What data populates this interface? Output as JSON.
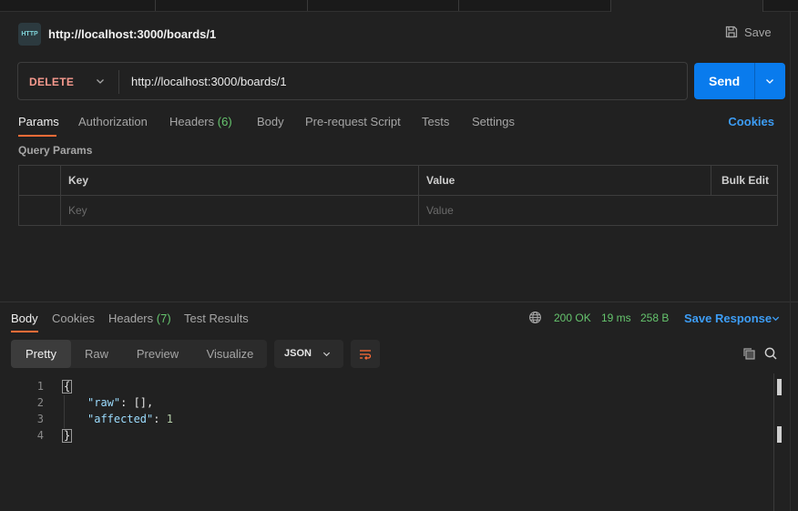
{
  "request": {
    "title": "http://localhost:3000/boards/1",
    "icon_text": "HTTP",
    "save_label": "Save",
    "method": "DELETE",
    "url": "http://localhost:3000/boards/1",
    "send_label": "Send"
  },
  "request_tabs": [
    {
      "label": "Params",
      "active": true
    },
    {
      "label": "Authorization"
    },
    {
      "label": "Headers",
      "count": "(6)"
    },
    {
      "label": "Body"
    },
    {
      "label": "Pre-request Script"
    },
    {
      "label": "Tests"
    },
    {
      "label": "Settings"
    }
  ],
  "cookies_label": "Cookies",
  "query_params": {
    "label": "Query Params",
    "headers": {
      "key": "Key",
      "value": "Value",
      "bulk_edit": "Bulk Edit"
    },
    "placeholders": {
      "key": "Key",
      "value": "Value"
    }
  },
  "response": {
    "tabs": [
      {
        "label": "Body",
        "active": true
      },
      {
        "label": "Cookies"
      },
      {
        "label": "Headers",
        "count": "(7)"
      },
      {
        "label": "Test Results"
      }
    ],
    "status": "200 OK",
    "time": "19 ms",
    "size": "258 B",
    "save_response_label": "Save Response",
    "views": [
      "Pretty",
      "Raw",
      "Preview",
      "Visualize"
    ],
    "format": "JSON",
    "body_lines": [
      {
        "n": "1",
        "text": "{"
      },
      {
        "n": "2",
        "key": "\"raw\"",
        "rest": ": [],"
      },
      {
        "n": "3",
        "key": "\"affected\"",
        "sep": ": ",
        "num": "1"
      },
      {
        "n": "4",
        "text": "}"
      }
    ]
  },
  "colors": {
    "accent_orange": "#ff6c37",
    "send_blue": "#097bed",
    "method_delete": "#f79a8e",
    "status_green": "#66c56e",
    "link_blue": "#3d9df5"
  }
}
